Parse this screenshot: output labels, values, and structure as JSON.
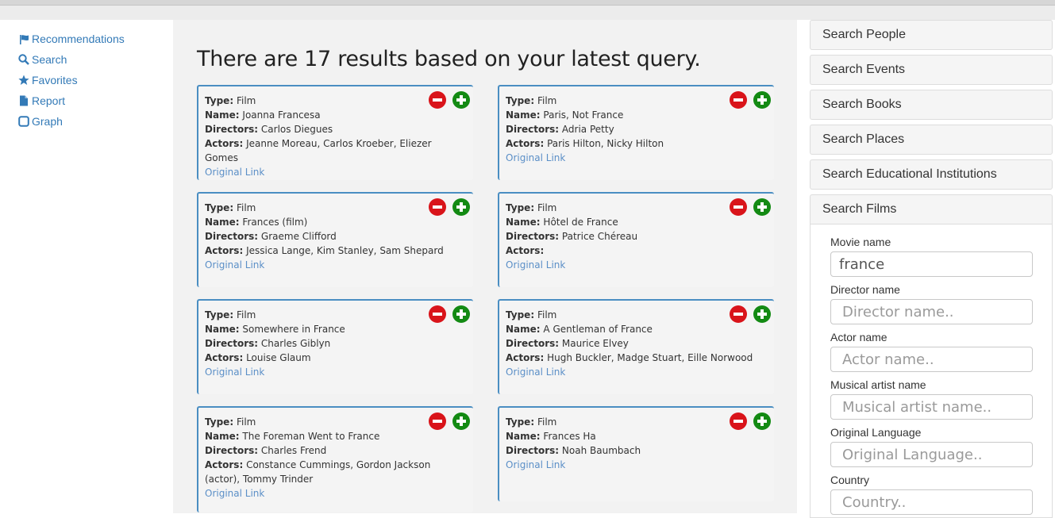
{
  "nav": {
    "items": [
      {
        "label": "Recommendations",
        "icon": "flag-icon"
      },
      {
        "label": "Search",
        "icon": "search-icon"
      },
      {
        "label": "Favorites",
        "icon": "star-icon"
      },
      {
        "label": "Report",
        "icon": "file-icon"
      },
      {
        "label": "Graph",
        "icon": "square-icon"
      }
    ]
  },
  "main": {
    "heading": "There are 17 results based on your latest query.",
    "labels": {
      "type": "Type:",
      "name": "Name:",
      "directors": "Directors:",
      "actors": "Actors:",
      "link": "Original Link"
    },
    "cards": [
      {
        "type": "Film",
        "name": "Joanna Francesa",
        "directors": "Carlos Diegues",
        "actors": "Jeanne Moreau, Carlos Kroeber, Eliezer Gomes"
      },
      {
        "type": "Film",
        "name": "Paris, Not France",
        "directors": "Adria Petty",
        "actors": "Paris Hilton, Nicky Hilton"
      },
      {
        "type": "Film",
        "name": "Frances (film)",
        "directors": "Graeme Clifford",
        "actors": "Jessica Lange, Kim Stanley, Sam Shepard"
      },
      {
        "type": "Film",
        "name": "Hôtel de France",
        "directors": "Patrice Chéreau",
        "actors": ""
      },
      {
        "type": "Film",
        "name": "Somewhere in France",
        "directors": "Charles Giblyn",
        "actors": "Louise Glaum"
      },
      {
        "type": "Film",
        "name": "A Gentleman of France",
        "directors": "Maurice Elvey",
        "actors": "Hugh Buckler, Madge Stuart, Eille Norwood"
      },
      {
        "type": "Film",
        "name": "The Foreman Went to France",
        "directors": "Charles Frend",
        "actors": "Constance Cummings, Gordon Jackson (actor), Tommy Trinder"
      },
      {
        "type": "Film",
        "name": "Frances Ha",
        "directors": "Noah Baumbach",
        "actors": null
      }
    ]
  },
  "sidebar": {
    "panels": [
      "Search People",
      "Search Events",
      "Search Books",
      "Search Places",
      "Search Educational Institutions"
    ],
    "open_panel": "Search Films",
    "fields": [
      {
        "label": "Movie name",
        "value": "france",
        "placeholder": ""
      },
      {
        "label": "Director name",
        "value": "",
        "placeholder": "Director name.."
      },
      {
        "label": "Actor name",
        "value": "",
        "placeholder": "Actor name.."
      },
      {
        "label": "Musical artist name",
        "value": "",
        "placeholder": "Musical artist name.."
      },
      {
        "label": "Original Language",
        "value": "",
        "placeholder": "Original Language.."
      },
      {
        "label": "Country",
        "value": "",
        "placeholder": "Country.."
      }
    ]
  },
  "colors": {
    "link": "#337ab7",
    "card_border": "#4a8ec2",
    "remove": "#d9141a",
    "add": "#138a13"
  }
}
